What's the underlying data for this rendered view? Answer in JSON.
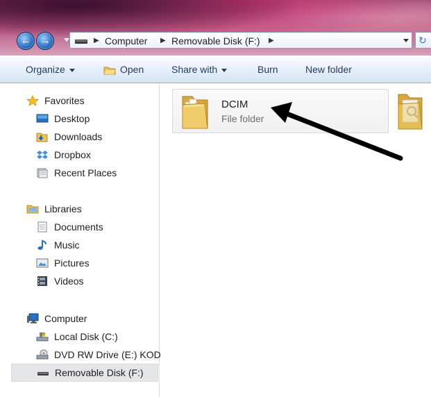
{
  "window": {
    "back_button_icon": "arrow-left-icon",
    "forward_button_icon": "arrow-right-icon"
  },
  "address_bar": {
    "crumbs": [
      "Computer",
      "Removable Disk (F:)"
    ]
  },
  "toolbar": {
    "organize": "Organize",
    "open": "Open",
    "share_with": "Share with",
    "burn": "Burn",
    "new_folder": "New folder"
  },
  "sidebar": {
    "favorites": {
      "label": "Favorites",
      "items": [
        "Desktop",
        "Downloads",
        "Dropbox",
        "Recent Places"
      ]
    },
    "libraries": {
      "label": "Libraries",
      "items": [
        "Documents",
        "Music",
        "Pictures",
        "Videos"
      ]
    },
    "computer": {
      "label": "Computer",
      "items": [
        "Local Disk (C:)",
        "DVD RW Drive (E:) KOD",
        "Removable Disk (F:)"
      ]
    },
    "selected_item": "Removable Disk (F:)"
  },
  "content": {
    "items": [
      {
        "name": "DCIM",
        "type": "File folder"
      }
    ]
  },
  "colors": {
    "toolbar_text": "#1e3a5f",
    "accent_blue": "#2f74c8",
    "folder_yellow": "#e8c25a",
    "annotation_arrow": "#000000"
  }
}
